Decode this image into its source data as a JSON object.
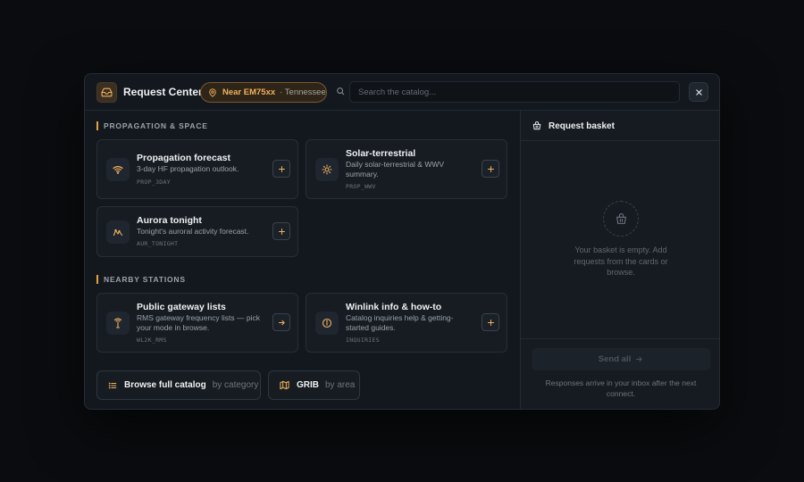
{
  "header": {
    "title": "Request Center",
    "location": {
      "grid": "Near EM75xx",
      "state": "· Tennessee"
    },
    "search": {
      "placeholder": "Search the catalog..."
    },
    "close_icon": "x-icon"
  },
  "sections": [
    {
      "label": "PROPAGATION & SPACE",
      "cards": [
        {
          "title": "Propagation forecast",
          "desc": "3-day HF propagation outlook.",
          "code": "PROP_3DAY",
          "icon": "wifi-signal-icon",
          "action": "add"
        },
        {
          "title": "Solar-terrestrial",
          "desc": "Daily solar-terrestrial & WWV summary.",
          "code": "PROP_WWV",
          "icon": "sun-icon",
          "action": "add"
        },
        {
          "title": "Aurora tonight",
          "desc": "Tonight's auroral activity forecast.",
          "code": "AUR_TONIGHT",
          "icon": "aurora-icon",
          "action": "add"
        }
      ]
    },
    {
      "label": "NEARBY STATIONS",
      "cards": [
        {
          "title": "Public gateway lists",
          "desc": "RMS gateway frequency lists — pick your mode in browse.",
          "code": "WL2K_RMS",
          "icon": "antenna-icon",
          "action": "open"
        },
        {
          "title": "Winlink info & how-to",
          "desc": "Catalog inquiries help & getting-started guides.",
          "code": "INQUIRIES",
          "icon": "info-icon",
          "action": "add"
        }
      ]
    }
  ],
  "footer_buttons": {
    "browse": {
      "label": "Browse full catalog",
      "sub": "by category"
    },
    "grib": {
      "label": "GRIB",
      "sub": "by area"
    }
  },
  "basket": {
    "title": "Request basket",
    "empty_text": "Your basket is empty. Add requests from the cards or browse.",
    "send_label": "Send all",
    "note": "Responses arrive in your inbox after the next connect."
  },
  "colors": {
    "accent": "#e5a144",
    "background": "#0a0c0f",
    "panel": "#13181e"
  }
}
